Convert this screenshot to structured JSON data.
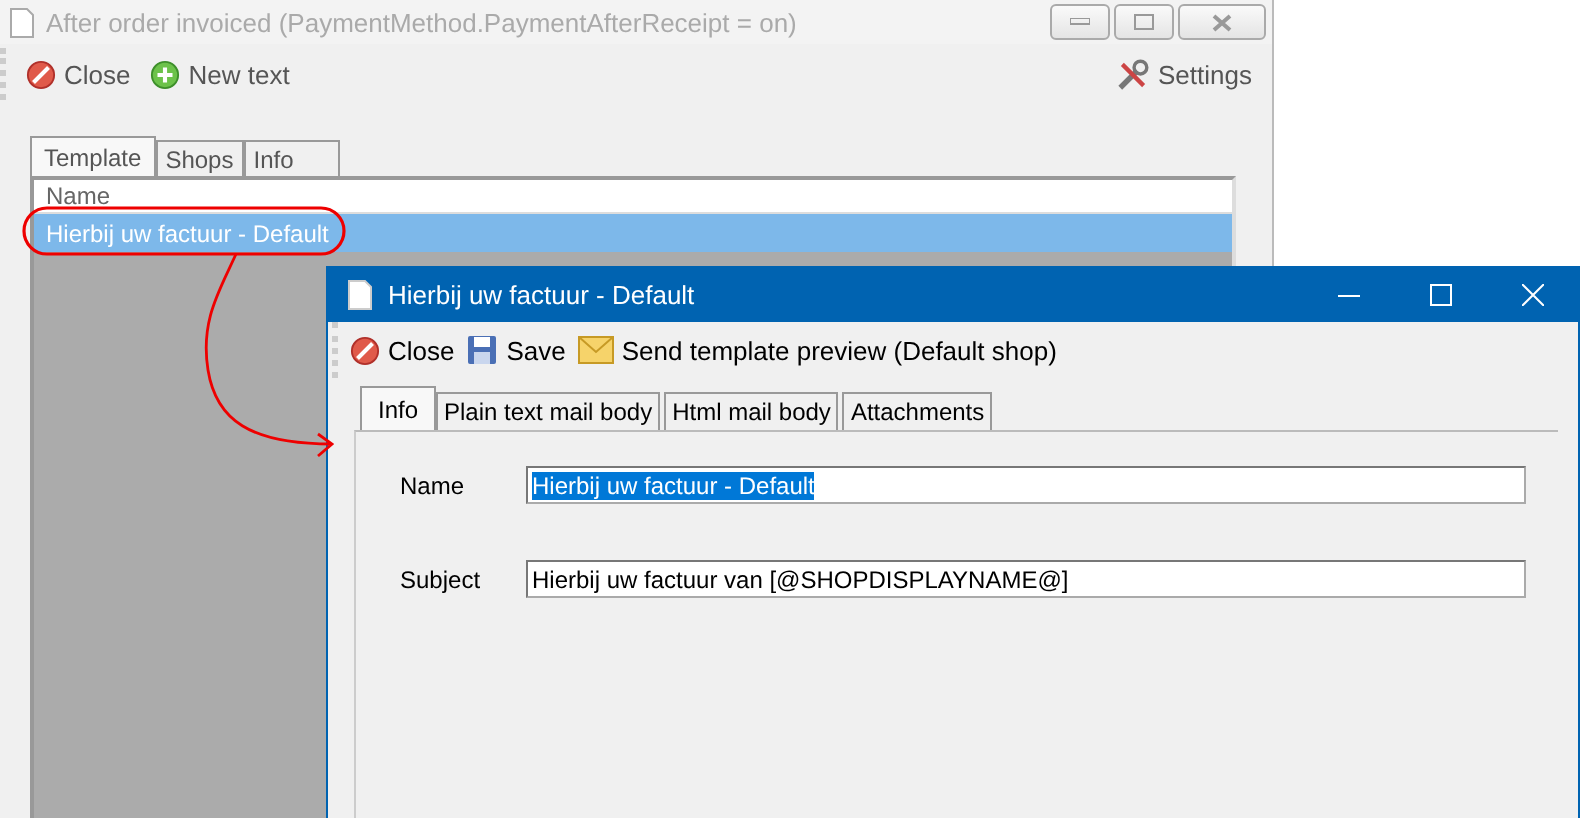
{
  "background_window": {
    "title": "After order invoiced (PaymentMethod.PaymentAfterReceipt = on)",
    "active": false,
    "toolbar": [
      {
        "kind": "close",
        "label": "Close"
      },
      {
        "kind": "new",
        "label": "New text"
      },
      {
        "kind": "settings",
        "label": "Settings"
      }
    ],
    "tabs": [
      {
        "label": "Template",
        "selected": true
      },
      {
        "label": "Shops",
        "selected": false
      },
      {
        "label": "Info",
        "selected": false
      }
    ],
    "list": {
      "columns": [
        "Name"
      ],
      "rows": [
        {
          "name": "Hierbij uw factuur - Default",
          "selected": true
        }
      ]
    }
  },
  "dialog": {
    "title": "Hierbij uw factuur - Default",
    "active": true,
    "toolbar": [
      {
        "kind": "close",
        "label": "Close"
      },
      {
        "kind": "save",
        "label": "Save"
      },
      {
        "kind": "mail",
        "label": "Send template preview (Default shop)"
      }
    ],
    "tabs": [
      {
        "label": "Info",
        "selected": true
      },
      {
        "label": "Plain text mail body",
        "selected": false
      },
      {
        "label": "Html mail body",
        "selected": false
      },
      {
        "label": "Attachments",
        "selected": false
      }
    ],
    "fields": [
      {
        "label": "Name",
        "value": "Hierbij uw factuur - Default",
        "text_selected": true
      },
      {
        "label": "Subject",
        "value": "Hierbij uw factuur van [@SHOPDISPLAYNAME@]",
        "text_selected": false
      }
    ]
  }
}
